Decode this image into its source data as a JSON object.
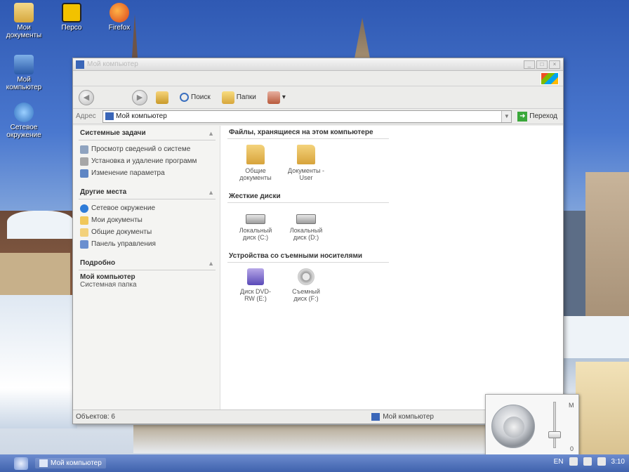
{
  "desktop": {
    "icons": [
      {
        "label": "Мои документы",
        "icon": "documents-folder-icon"
      },
      {
        "label": "Персо",
        "icon": "batman-icon"
      },
      {
        "label": "Firefox",
        "icon": "firefox-icon"
      },
      {
        "label": "Мой компьютер",
        "icon": "my-computer-icon"
      },
      {
        "label": "Сетевое окружение",
        "icon": "network-icon"
      }
    ]
  },
  "window": {
    "title": "Мой компьютер",
    "toolbar": {
      "back_icon": "back-arrow-icon",
      "forward_icon": "forward-arrow-icon",
      "search_label": "Поиск",
      "folders_label": "Папки"
    },
    "address": {
      "label": "Адрес",
      "value": "Мой компьютер",
      "go_label": "Переход"
    },
    "taskpane": {
      "system_tasks": {
        "title": "Системные задачи",
        "items": [
          "Просмотр сведений о системе",
          "Установка и удаление программ",
          "Изменение параметра"
        ]
      },
      "other_places": {
        "title": "Другие места",
        "items": [
          "Сетевое окружение",
          "Мои документы",
          "Общие документы",
          "Панель управления"
        ]
      },
      "details": {
        "title": "Подробно",
        "name": "Мой компьютер",
        "type": "Системная папка"
      }
    },
    "groups": {
      "files": {
        "title": "Файлы, хранящиеся на этом компьютере",
        "items": [
          "Общие документы",
          "Документы - User"
        ]
      },
      "drives": {
        "title": "Жесткие диски",
        "items": [
          "Локальный диск (C:)",
          "Локальный диск (D:)"
        ]
      },
      "removable": {
        "title": "Устройства со съемными носителями",
        "items": [
          "Диск DVD-RW (E:)",
          "Съемный диск (F:)"
        ]
      }
    },
    "status": {
      "left": "Объектов: 6",
      "right": "Мой компьютер"
    }
  },
  "taskbar": {
    "task_label": "Мой компьютер",
    "tray_lang": "EN",
    "clock": "3:10"
  },
  "volume": {
    "max_label": "M",
    "min_label": "0",
    "level": 0.3
  }
}
